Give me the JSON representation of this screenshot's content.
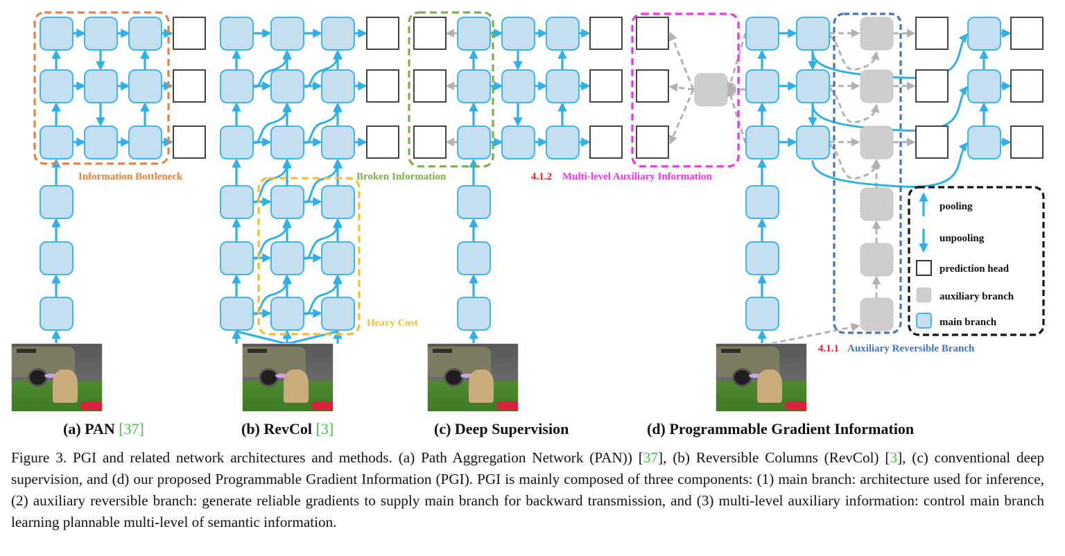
{
  "figure": {
    "panels": [
      {
        "id": "a",
        "title": "(a) PAN ",
        "ref": "[37]"
      },
      {
        "id": "b",
        "title": "(b) RevCol ",
        "ref": "[3]"
      },
      {
        "id": "c",
        "title": "(c) Deep Supervision",
        "ref": ""
      },
      {
        "id": "d",
        "title": "(d) Programmable Gradient Information",
        "ref": ""
      }
    ],
    "annotations": {
      "info_bottleneck": "Information  Bottleneck",
      "heavy_cost": "Heavy Cost",
      "broken_info": "Broken Information",
      "mla_num": "4.1.2",
      "mla_text": "Multi-level Auxiliary  Information",
      "arb_num": "4.1.1",
      "arb_text": "Auxiliary  Reversible Branch"
    },
    "legend": [
      {
        "icon": "pooling-arrow-up",
        "label": "pooling"
      },
      {
        "icon": "unpooling-arrow-down",
        "label": "unpooling"
      },
      {
        "icon": "prediction-head-box",
        "label": "prediction head"
      },
      {
        "icon": "auxiliary-branch-box",
        "label": "auxiliary branch"
      },
      {
        "icon": "main-branch-box",
        "label": "main branch"
      }
    ],
    "colors": {
      "main_fill": "#c5dff0",
      "main_stroke": "#3fb5ea",
      "arrow": "#2eb0ea",
      "aux_fill": "#cfcdcd",
      "aux_arrow": "#b3b2b2",
      "bottleneck": "#e8813f",
      "heavy_cost": "#f7bc2f",
      "broken": "#7ab04a",
      "multilevel": "#ee33ee",
      "reversible": "#4472c4",
      "section_num": "#ee1c25",
      "ref_green": "#3ec63e"
    }
  },
  "caption": {
    "lead": "Figure 3.  PGI and related network architectures and methods.  (a) Path Aggregation Network (PAN)) ",
    "ref1": "37",
    "mid1": "], (b) Reversible Columns (RevCol) [",
    "ref2": "3",
    "rest": "], (c) conventional deep supervision, and (d) our proposed Programmable Gradient Information (PGI). PGI is mainly composed of three components: (1) main branch: architecture used for inference, (2) auxiliary reversible branch: generate reliable gradients to supply main branch for backward transmission, and (3) multi-level auxiliary information: control main branch learning plannable multi-level of semantic information."
  }
}
